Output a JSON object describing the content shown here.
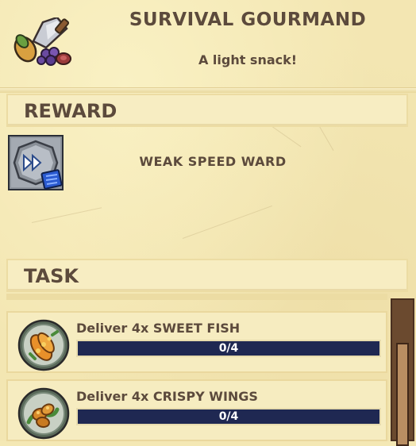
{
  "quest": {
    "title": "SURVIVAL GOURMAND",
    "subtitle": "A light snack!",
    "icon": "cleaver-and-food-icon"
  },
  "reward": {
    "section_label": "REWARD",
    "item_name": "WEAK SPEED WARD",
    "icon": "speed-ward-icon"
  },
  "task": {
    "section_label": "TASK",
    "items": [
      {
        "label": "Deliver 4x SWEET FISH",
        "progress_text": "0/4",
        "progress": 0,
        "icon": "sweet-fish-icon"
      },
      {
        "label": "Deliver 4x CRISPY WINGS",
        "progress_text": "0/4",
        "progress": 0,
        "icon": "crispy-wings-icon"
      }
    ]
  },
  "colors": {
    "parchment": "#f3e6b2",
    "text": "#5c4a3c",
    "progress_track": "#1f2852",
    "scrollbar": "#6b4a2f"
  }
}
